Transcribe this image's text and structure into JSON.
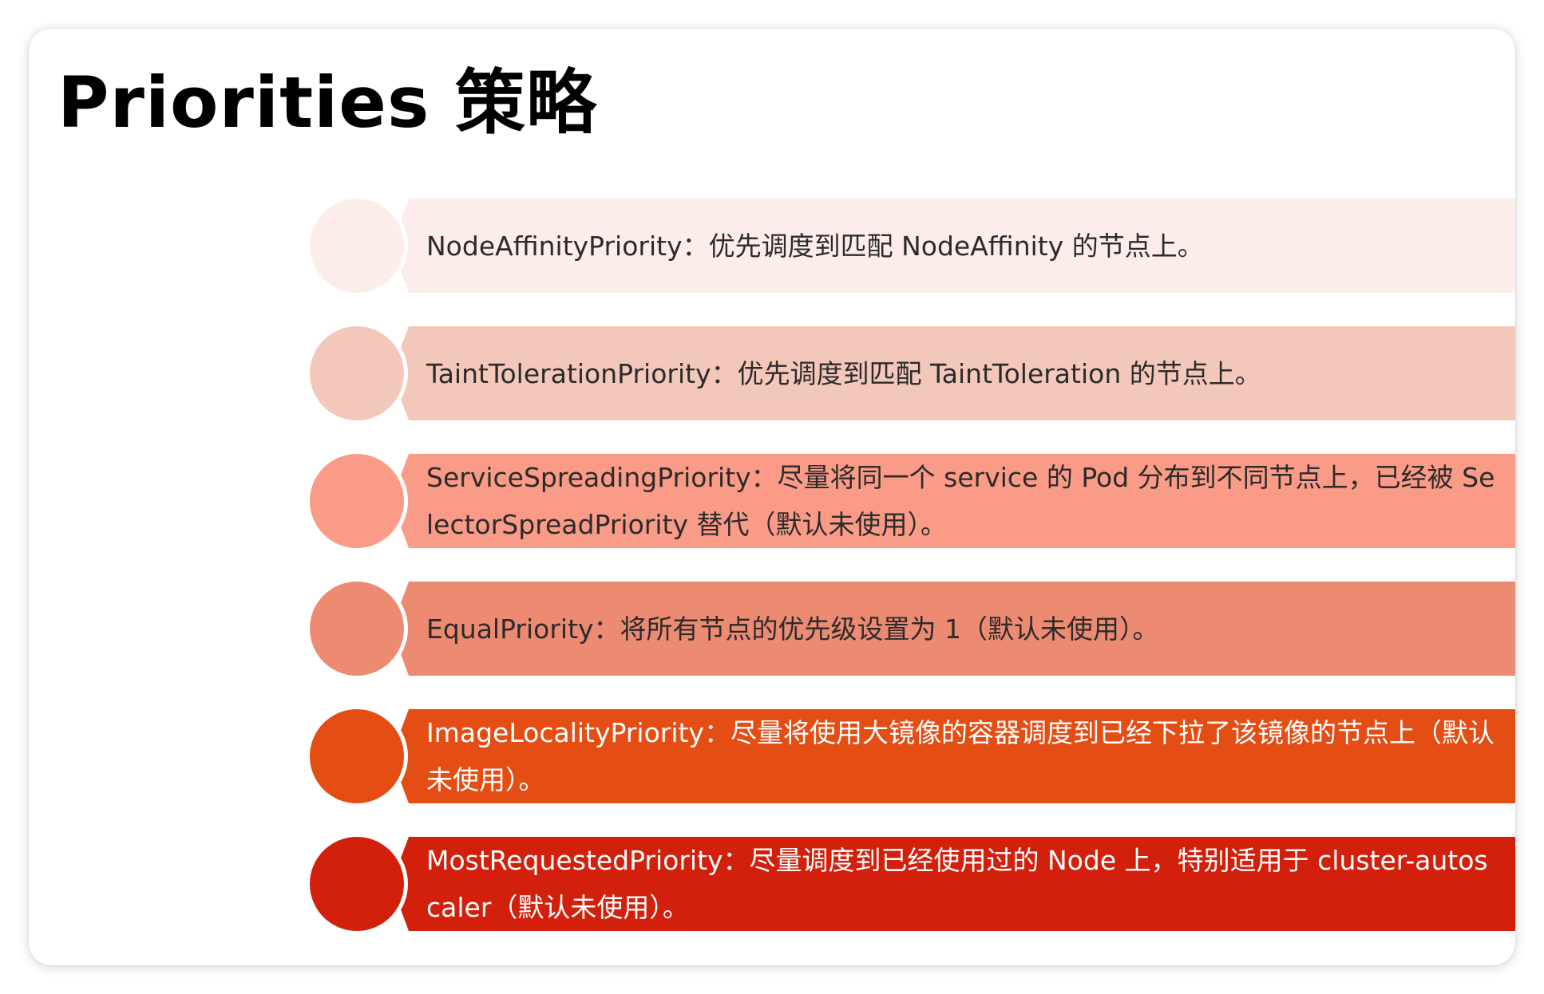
{
  "title": "Priorities 策略",
  "items": [
    {
      "text": "NodeAffinityPriority：优先调度到匹配 NodeAffinity 的节点上。",
      "color": "#FCEDEA",
      "text_color": "#2b2b2b"
    },
    {
      "text": "TaintTolerationPriority：优先调度到匹配 TaintToleration 的节点上。",
      "color": "#F4C7BB",
      "text_color": "#2b2b2b"
    },
    {
      "text": "ServiceSpreadingPriority：尽量将同一个 service 的 Pod 分布到不同节点上，已经被 SelectorSpreadPriority 替代（默认未使用）。",
      "color": "#FA9B88",
      "text_color": "#2b2b2b"
    },
    {
      "text": "EqualPriority：将所有节点的优先级设置为 1（默认未使用）。",
      "color": "#ED8A72",
      "text_color": "#2b2b2b"
    },
    {
      "text": "ImageLocalityPriority：尽量将使用大镜像的容器调度到已经下拉了该镜像的节点上（默认未使用）。",
      "color": "#E44D13",
      "text_color": "#ffffff"
    },
    {
      "text": "MostRequestedPriority：尽量调度到已经使用过的 Node 上，特别适用于 cluster-autoscaler（默认未使用）。",
      "color": "#D3200C",
      "text_color": "#ffffff"
    }
  ]
}
